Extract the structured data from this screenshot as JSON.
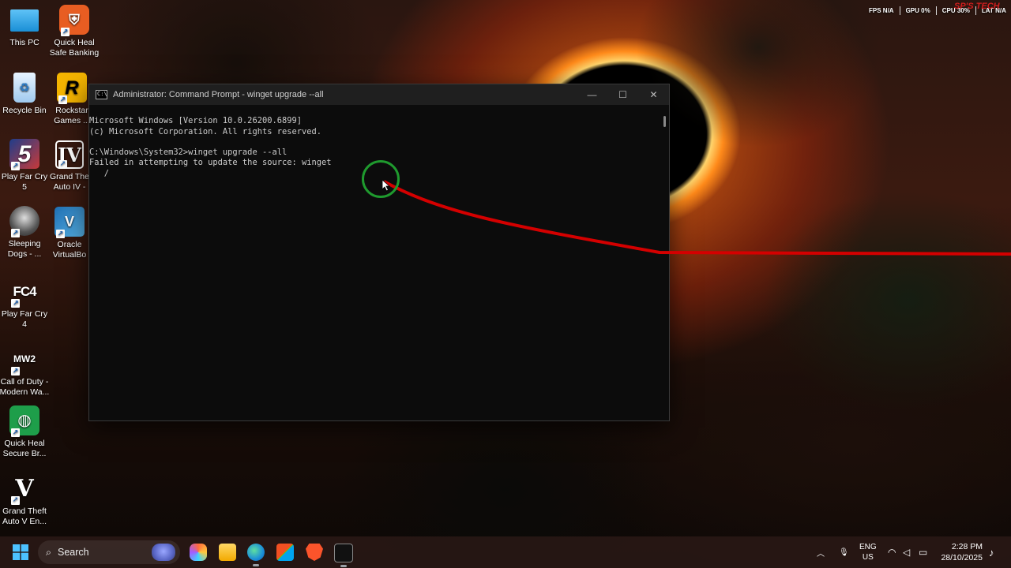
{
  "desktop": {
    "icons": [
      {
        "label": "This PC"
      },
      {
        "label": "Quick Heal Safe Banking"
      },
      {
        "label": "Recycle Bin"
      },
      {
        "label": "Rockstar Games ..."
      },
      {
        "label": "Play Far Cry 5"
      },
      {
        "label": "Grand The Auto IV -"
      },
      {
        "label": "Sleeping Dogs - ..."
      },
      {
        "label": "Oracle VirtualBo"
      },
      {
        "label": "Play Far Cry 4"
      },
      {
        "label": "Call of Duty - Modern Wa..."
      },
      {
        "label": "Quick Heal Secure Br..."
      },
      {
        "label": "Grand Theft Auto V En..."
      }
    ],
    "icon_glyphs": {
      "rockstar": "R",
      "gta4": "IV",
      "fc5": "5",
      "fc4": "FC4",
      "mw2": "MW2",
      "gta5": "V"
    }
  },
  "cmd_window": {
    "title": "Administrator: Command Prompt - winget  upgrade --all",
    "app_icon_text": "C:\\",
    "controls": {
      "minimize": "—",
      "maximize": "☐",
      "close": "✕"
    },
    "lines": [
      "Microsoft Windows [Version 10.0.26200.6899]",
      "(c) Microsoft Corporation. All rights reserved.",
      "",
      "C:\\Windows\\System32>winget upgrade --all",
      "Failed in attempting to update the source: winget",
      "   /"
    ]
  },
  "overlay_stats": {
    "fps_label": "FPS",
    "fps_value": "N/A",
    "gpu_label": "GPU",
    "gpu_value": "0%",
    "cpu_label": "CPU",
    "cpu_value": "30%",
    "lat_label": "LAT",
    "lat_value": "N/A",
    "watermark": "SP'S TECH"
  },
  "taskbar": {
    "search_placeholder": "Search",
    "tray": {
      "language_top": "ENG",
      "language_bottom": "US",
      "time": "2:28 PM",
      "date": "28/10/2025"
    },
    "colors": {
      "accent": "#0078d4",
      "taskbar_bg": "#2b1a15"
    }
  },
  "colors": {
    "annotation_ring": "#1f9a2e",
    "annotation_line": "#d40000"
  }
}
